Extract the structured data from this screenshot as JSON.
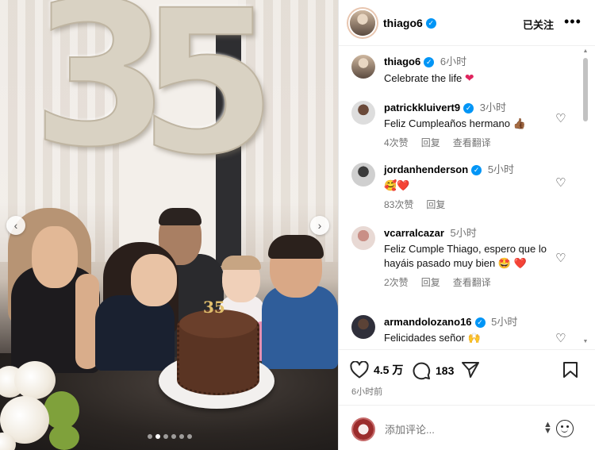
{
  "post": {
    "image_alt": "family birthday photo",
    "carousel": {
      "total_dots": 6,
      "active_index": 1
    }
  },
  "header": {
    "username": "thiago6",
    "follow_label": "已关注",
    "more_label": "•••"
  },
  "caption": {
    "username": "thiago6",
    "time": "6小时",
    "text": "Celebrate the life"
  },
  "comments": [
    {
      "username": "patrickkluivert9",
      "verified": true,
      "time": "3小时",
      "text": "Feliz Cumpleaños hermano",
      "emoji": "👍🏾",
      "likes": "4次赞",
      "reply": "回复",
      "translate": "查看翻译"
    },
    {
      "username": "jordanhenderson",
      "verified": true,
      "time": "5小时",
      "text": "",
      "emoji": "🥰❤️",
      "likes": "83次赞",
      "reply": "回复",
      "translate": ""
    },
    {
      "username": "vcarralcazar",
      "verified": false,
      "time": "5小时",
      "text": "Feliz Cumple Thiago, espero que lo hayáis pasado muy bien",
      "emoji": "🤩 ❤️",
      "likes": "2次赞",
      "reply": "回复",
      "translate": "查看翻译"
    },
    {
      "username": "armandolozano16",
      "verified": true,
      "time": "5小时",
      "text": "Felicidades señor",
      "emoji": "🙌",
      "likes": "",
      "reply": "",
      "translate": ""
    }
  ],
  "actions": {
    "likes_count": "4.5 万",
    "comments_count": "183",
    "timestamp": "6小时前"
  },
  "input": {
    "placeholder": "添加评论..."
  },
  "colors": {
    "verified": "#0095f6",
    "heart": "#e0245e",
    "muted_text": "#737373"
  },
  "icons": [
    "heart-icon",
    "comment-icon",
    "share-icon",
    "bookmark-icon",
    "smile-icon",
    "more-icon",
    "chevron-left-icon",
    "chevron-right-icon"
  ]
}
